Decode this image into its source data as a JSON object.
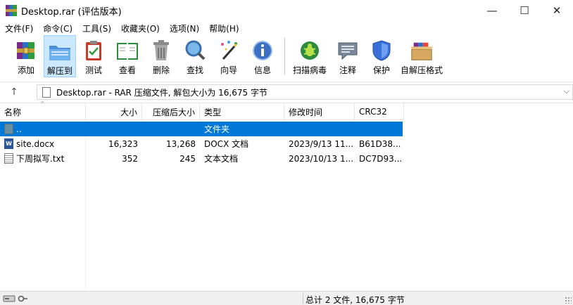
{
  "window": {
    "title": "Desktop.rar (评估版本)",
    "minimize": "—",
    "maximize": "☐",
    "close": "✕"
  },
  "menu": [
    "文件(F)",
    "命令(C)",
    "工具(S)",
    "收藏夹(O)",
    "选项(N)",
    "帮助(H)"
  ],
  "toolbar": {
    "add": "添加",
    "extract_to": "解压到",
    "test": "测试",
    "view": "查看",
    "delete": "删除",
    "find": "查找",
    "wizard": "向导",
    "info": "信息",
    "virus_scan": "扫描病毒",
    "comment": "注释",
    "protect": "保护",
    "sfx": "自解压格式"
  },
  "address": {
    "up_icon": "up-arrow-icon",
    "text": "Desktop.rar - RAR 压缩文件, 解包大小为 16,675 字节"
  },
  "columns": {
    "name": "名称",
    "size": "大小",
    "packed": "压缩后大小",
    "type": "类型",
    "modified": "修改时间",
    "crc": "CRC32"
  },
  "rows": [
    {
      "name": "..",
      "size": "",
      "packed": "",
      "type": "文件夹",
      "modified": "",
      "crc": "",
      "icon": "folder-icon",
      "selected": true
    },
    {
      "name": "site.docx",
      "size": "16,323",
      "packed": "13,268",
      "type": "DOCX 文档",
      "modified": "2023/9/13 11...",
      "crc": "B61D38...",
      "icon": "word-doc-icon",
      "selected": false
    },
    {
      "name": "下周拟写.txt",
      "size": "352",
      "packed": "245",
      "type": "文本文档",
      "modified": "2023/10/13 1...",
      "crc": "DC7D93...",
      "icon": "text-file-icon",
      "selected": false
    }
  ],
  "status": {
    "summary": "总计 2 文件, 16,675 字节"
  },
  "colors": {
    "selection": "#0078d7",
    "active_tool": "#cce8ff"
  }
}
